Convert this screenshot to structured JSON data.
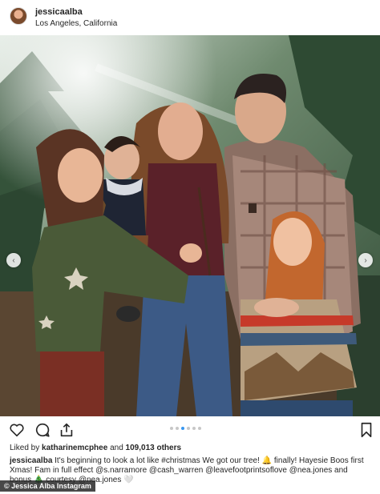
{
  "post": {
    "username": "jessicaalba",
    "location": "Los Angeles, California"
  },
  "carousel": {
    "prev_arrow": "‹",
    "next_arrow": "›",
    "dots_count": 6,
    "active_dot": 2
  },
  "icons": {
    "like": "heart-icon",
    "comment": "comment-icon",
    "share": "share-icon",
    "save": "bookmark-icon"
  },
  "likes": {
    "prefix": "Liked by",
    "user": "katharinemcphee",
    "joiner": "and",
    "others": "109,013 others"
  },
  "caption": {
    "username": "jessicaalba",
    "text": " It's beginning to look a lot like #christmas We got our tree! 🔔 finally! Hayesie Boos first Xmas! Fam in full effect @s.narramore @cash_warren @leavefootprintsoflove @nea.jones and bonus 🎄 courtesy @nea.jones 🤍"
  },
  "credit": "© Jessica Alba Instagram",
  "colors": {
    "accent": "#3897f0",
    "text": "#262626"
  }
}
